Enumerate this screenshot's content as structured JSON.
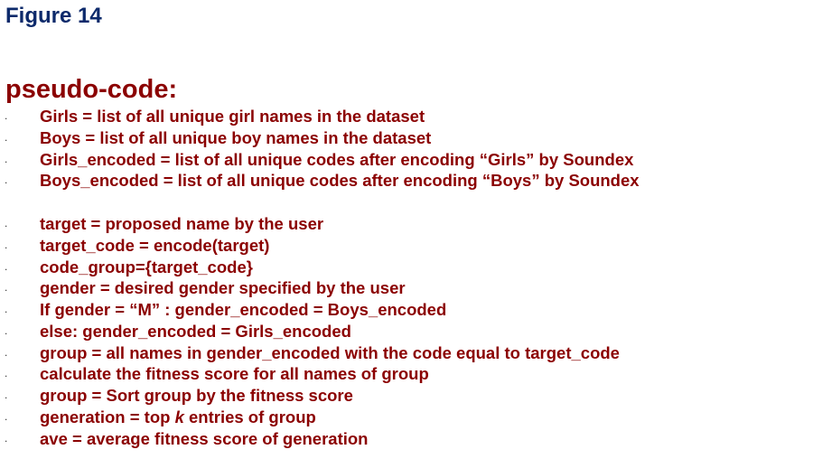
{
  "figure_label": "Figure 14",
  "heading": "pseudo-code:",
  "bullet_glyph": ".",
  "block1": [
    "Girls = list of all unique girl names in the dataset",
    "Boys = list of all unique boy names in the dataset",
    "Girls_encoded = list of all unique codes after encoding “Girls” by Soundex",
    "Boys_encoded = list of all unique codes after encoding “Boys” by Soundex"
  ],
  "block2": [
    "target = proposed name by the user",
    "target_code = encode(target)",
    "code_group={target_code}",
    "gender = desired gender specified by the user",
    "If gender = “M” : gender_encoded = Boys_encoded",
    "else: gender_encoded = Girls_encoded",
    "group = all names in gender_encoded with the code equal to target_code",
    "calculate the fitness score for all names of group",
    "group = Sort group by the fitness score"
  ],
  "generation_line": {
    "before": "generation = top ",
    "italic": "k",
    "after": " entries of group"
  },
  "last_line": "ave = average fitness score of generation",
  "colors": {
    "title": "#0d2a6b",
    "code_text": "#8b0000"
  }
}
